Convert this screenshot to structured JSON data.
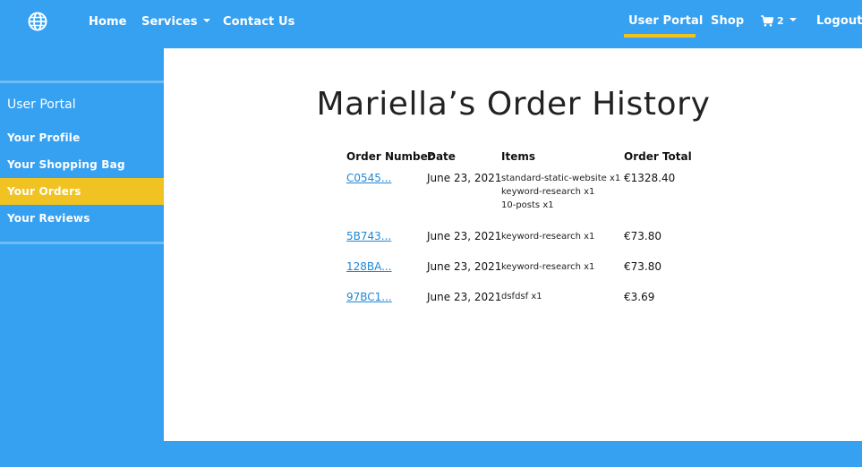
{
  "nav": {
    "home": "Home",
    "services": "Services",
    "contact": "Contact Us",
    "user_portal": "User Portal",
    "shop": "Shop",
    "cart_count": "2",
    "logout": "Logout"
  },
  "sidebar": {
    "title": "User Portal",
    "items": [
      {
        "label": "Your Profile"
      },
      {
        "label": "Your Shopping Bag"
      },
      {
        "label": "Your Orders"
      },
      {
        "label": "Your Reviews"
      }
    ]
  },
  "main": {
    "title": "Mariella’s Order History",
    "columns": [
      "Order Number",
      "Date",
      "Items",
      "Order Total"
    ],
    "rows": [
      {
        "order": "C0545...",
        "date": "June 23, 2021",
        "items": [
          "standard-static-website x1",
          "keyword-research x1",
          "10-posts x1"
        ],
        "total": "€1328.40"
      },
      {
        "order": "5B743...",
        "date": "June 23, 2021",
        "items": [
          "keyword-research x1"
        ],
        "total": "€73.80"
      },
      {
        "order": "128BA...",
        "date": "June 23, 2021",
        "items": [
          "keyword-research x1"
        ],
        "total": "€73.80"
      },
      {
        "order": "97BC1...",
        "date": "June 23, 2021",
        "items": [
          "dsfdsf x1"
        ],
        "total": "€3.69"
      }
    ]
  },
  "colors": {
    "brand": "#36a0f1",
    "accent": "#f0c322",
    "link": "#1e88d8"
  },
  "icons": {
    "logo": "globe-icon",
    "cart": "shopping-cart-icon",
    "dropdown": "caret-down-icon"
  }
}
